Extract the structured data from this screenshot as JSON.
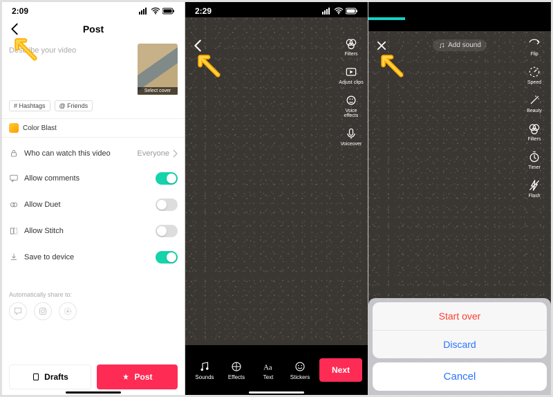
{
  "phone1": {
    "time": "2:09",
    "title": "Post",
    "desc_placeholder": "Describe your video",
    "cover_label": "Select cover",
    "tag_hashtags": "# Hashtags",
    "tag_friends": "@ Friends",
    "effect_name": "Color Blast",
    "privacy_label": "Who can watch this video",
    "privacy_value": "Everyone",
    "comments_label": "Allow comments",
    "duet_label": "Allow Duet",
    "stitch_label": "Allow Stitch",
    "save_label": "Save to device",
    "share_label": "Automatically share to:",
    "drafts_btn": "Drafts",
    "post_btn": "Post"
  },
  "phone2": {
    "time": "2:29",
    "side": {
      "filters": "Filters",
      "adjust": "Adjust clips",
      "voice": "Voice effects",
      "voiceover": "Voiceover"
    },
    "tools": {
      "sounds": "Sounds",
      "effects": "Effects",
      "text": "Text",
      "stickers": "Stickers"
    },
    "next": "Next"
  },
  "phone3": {
    "addsound": "Add sound",
    "side": {
      "flip": "Flip",
      "speed": "Speed",
      "beauty": "Beauty",
      "filters": "Filters",
      "timer": "Timer",
      "flash": "Flash"
    },
    "sheet": {
      "startover": "Start over",
      "discard": "Discard",
      "cancel": "Cancel"
    },
    "progress_pct": 20
  }
}
